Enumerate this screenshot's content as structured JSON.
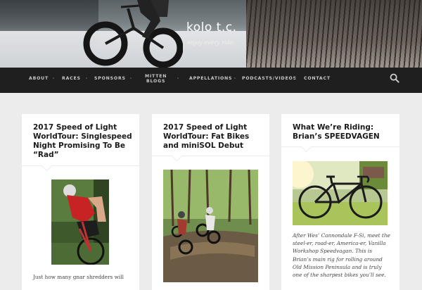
{
  "site": {
    "title": "kolo t.c.",
    "tagline": "enjoy every ride."
  },
  "nav": {
    "items": [
      {
        "lines": [
          "ABOUT"
        ]
      },
      {
        "lines": [
          "RACES"
        ]
      },
      {
        "lines": [
          "SPONSORS"
        ]
      },
      {
        "lines": [
          "MITTEN",
          "BLOGS"
        ]
      },
      {
        "lines": [
          "APPELLATIONS"
        ]
      },
      {
        "lines": [
          "PODCASTS/VIDEOS"
        ]
      },
      {
        "lines": [
          "CONTACT"
        ]
      }
    ],
    "search_icon": "search-icon"
  },
  "posts": [
    {
      "title_lines": [
        "2017 Speed of Light",
        "WorldTour: Singlespeed",
        "Night Promising To Be",
        "“Rad”"
      ],
      "excerpt_lines": [
        "Just how many gnar shredders will"
      ]
    },
    {
      "title_lines": [
        "2017 Speed of Light",
        "WorldTour: Fat Bikes",
        "and miniSOL Debut"
      ],
      "excerpt_lines": []
    },
    {
      "title_lines": [
        "What We’re Riding:",
        "Brian’s SPEEDVAGEN"
      ],
      "excerpt_lines": [
        "After Wes’ Cannondale F-Si, meet the",
        "steel-er, road-er, America-er, Vanilla",
        "Workshop Speedvagan. This is",
        "Brian’s main rig for rolling around",
        "Old Mission Peninsula and is truly",
        "one of the sharpest bikes you’ll see."
      ]
    }
  ]
}
